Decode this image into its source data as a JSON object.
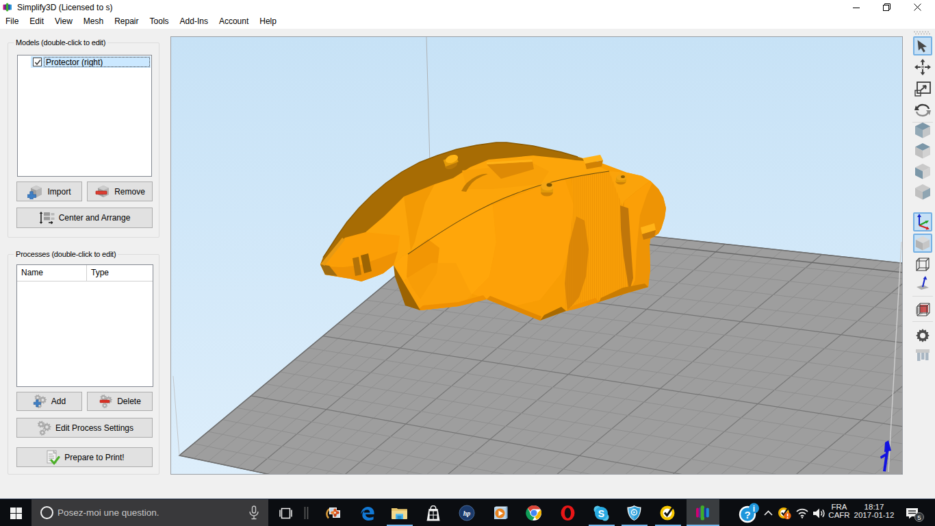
{
  "window": {
    "title": "Simplify3D (Licensed to s)",
    "controls": {
      "minimize": "minimize",
      "restore": "restore-down",
      "close": "close"
    }
  },
  "menubar": {
    "items": [
      "File",
      "Edit",
      "View",
      "Mesh",
      "Repair",
      "Tools",
      "Add-Ins",
      "Account",
      "Help"
    ]
  },
  "models_panel": {
    "title": "Models (double-click to edit)",
    "items": [
      {
        "label": "Protector (right)",
        "checked": true,
        "selected": true
      }
    ],
    "buttons": {
      "import": "Import",
      "remove": "Remove",
      "center_arrange": "Center and Arrange"
    }
  },
  "processes_panel": {
    "title": "Processes (double-click to edit)",
    "columns": {
      "name": "Name",
      "type": "Type"
    },
    "rows": [],
    "buttons": {
      "add": "Add",
      "delete": "Delete",
      "edit": "Edit Process Settings",
      "prepare": "Prepare to Print!"
    }
  },
  "right_toolbar": {
    "tools": [
      {
        "name": "select-arrow",
        "selected": true
      },
      {
        "name": "translate"
      },
      {
        "name": "scale"
      },
      {
        "name": "rotate"
      },
      {
        "name": "view-isometric"
      },
      {
        "name": "view-top"
      },
      {
        "name": "view-front"
      },
      {
        "name": "view-side"
      },
      {
        "name": "coordinate-axes",
        "selected": true
      },
      {
        "name": "solid-render",
        "selected": true
      },
      {
        "name": "wireframe-render"
      },
      {
        "name": "surface-normals"
      },
      {
        "name": "cross-section"
      },
      {
        "name": "machine-settings-gear"
      },
      {
        "name": "machine-control-panel"
      }
    ]
  },
  "viewport": {
    "model_name": "Protector (right)",
    "colors": {
      "bg_top": "#c7e2f6",
      "bg_bottom": "#ddeefb",
      "plate": "#9d9d9d",
      "grid_minor": "#909090",
      "grid_major": "#7a7a7a",
      "model_orange": "#f89c03",
      "model_dark_band": "#a96e06",
      "z_axis_blue": "#1616dd"
    }
  },
  "taskbar": {
    "search_placeholder": "Posez-moi une question.",
    "language": {
      "line1": "FRA",
      "line2": "CAFR"
    },
    "clock": {
      "time": "18:17",
      "date": "2017-01-12"
    },
    "notification_count": "5",
    "apps": [
      "task-view",
      "photos",
      "edge",
      "file-explorer",
      "store",
      "hp",
      "media-player",
      "chrome",
      "opera",
      "skype",
      "security-shield",
      "norton",
      "simplify3d"
    ],
    "tray": [
      "hp-support",
      "chevron-up",
      "norton-alert",
      "wifi",
      "volume",
      "language",
      "clock",
      "notifications"
    ]
  }
}
